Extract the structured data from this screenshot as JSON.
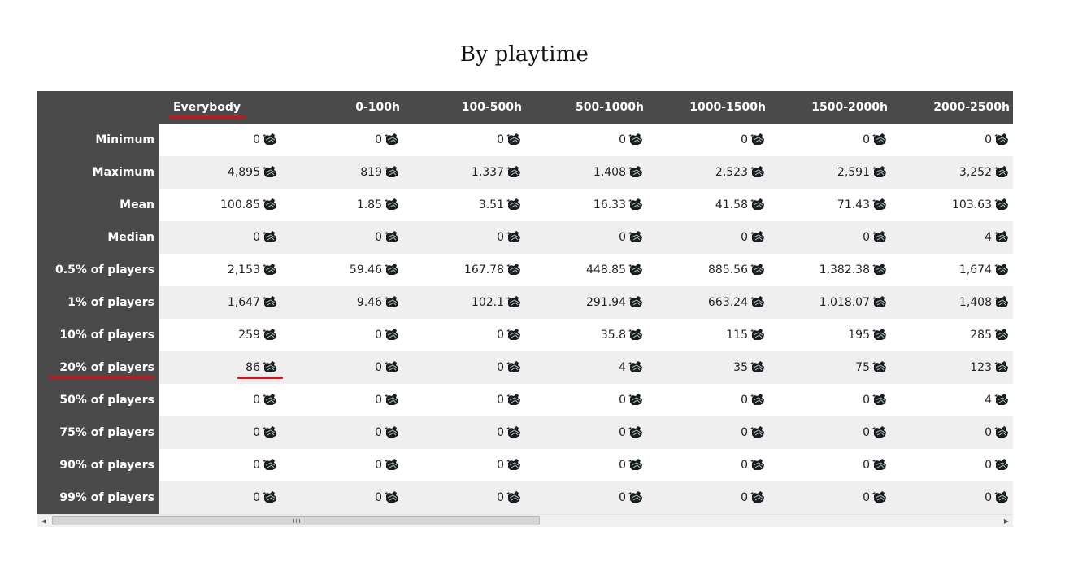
{
  "page": {
    "title": "By playtime"
  },
  "table": {
    "columns": [
      "Everybody",
      "0-100h",
      "100-500h",
      "500-1000h",
      "1000-1500h",
      "1500-2000h",
      "2000-2500h"
    ],
    "rows": [
      {
        "label": "Minimum",
        "values": [
          "0",
          "0",
          "0",
          "0",
          "0",
          "0",
          "0"
        ]
      },
      {
        "label": "Maximum",
        "values": [
          "4,895",
          "819",
          "1,337",
          "1,408",
          "2,523",
          "2,591",
          "3,252"
        ]
      },
      {
        "label": "Mean",
        "values": [
          "100.85",
          "1.85",
          "3.51",
          "16.33",
          "41.58",
          "71.43",
          "103.63"
        ]
      },
      {
        "label": "Median",
        "values": [
          "0",
          "0",
          "0",
          "0",
          "0",
          "0",
          "4"
        ]
      },
      {
        "label": "0.5% of players",
        "values": [
          "2,153",
          "59.46",
          "167.78",
          "448.85",
          "885.56",
          "1,382.38",
          "1,674"
        ]
      },
      {
        "label": "1% of players",
        "values": [
          "1,647",
          "9.46",
          "102.1",
          "291.94",
          "663.24",
          "1,018.07",
          "1,408"
        ]
      },
      {
        "label": "10% of players",
        "values": [
          "259",
          "0",
          "0",
          "35.8",
          "115",
          "195",
          "285"
        ]
      },
      {
        "label": "20% of players",
        "values": [
          "86",
          "0",
          "0",
          "4",
          "35",
          "75",
          "123"
        ]
      },
      {
        "label": "50% of players",
        "values": [
          "0",
          "0",
          "0",
          "0",
          "0",
          "0",
          "4"
        ]
      },
      {
        "label": "75% of players",
        "values": [
          "0",
          "0",
          "0",
          "0",
          "0",
          "0",
          "0"
        ]
      },
      {
        "label": "90% of players",
        "values": [
          "0",
          "0",
          "0",
          "0",
          "0",
          "0",
          "0"
        ]
      },
      {
        "label": "99% of players",
        "values": [
          "0",
          "0",
          "0",
          "0",
          "0",
          "0",
          "0"
        ]
      }
    ],
    "value_icon": "loot-bag-icon"
  },
  "scrollbar": {
    "left_arrow": "◀",
    "right_arrow": "▶"
  },
  "colors": {
    "header_bg": "#4a4a4a",
    "row_alt_bg": "#efefef",
    "highlight_underline": "#d90f16"
  }
}
